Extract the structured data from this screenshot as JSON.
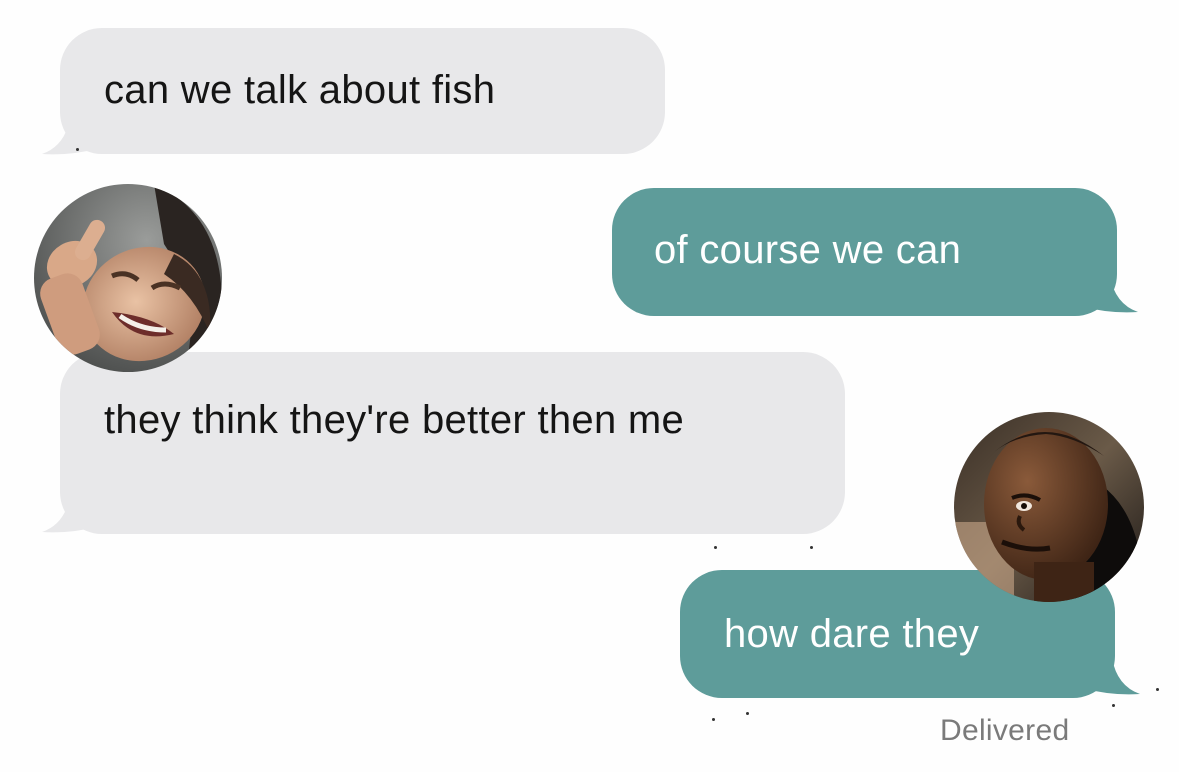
{
  "conversation": {
    "messages": [
      {
        "direction": "incoming",
        "text": "can we talk about fish"
      },
      {
        "direction": "outgoing",
        "text": "of course we can"
      },
      {
        "direction": "incoming",
        "text": "they think they're better then me"
      },
      {
        "direction": "outgoing",
        "text": "how dare they"
      }
    ],
    "status": "Delivered"
  },
  "colors": {
    "incoming_bubble": "#e8e8ea",
    "outgoing_bubble": "#5e9c9a",
    "incoming_text": "#151515",
    "outgoing_text": "#ffffff",
    "status_text": "#7a7a7a"
  },
  "avatars": [
    {
      "icon": "laughing-man-photo"
    },
    {
      "icon": "smirking-man-photo"
    }
  ]
}
